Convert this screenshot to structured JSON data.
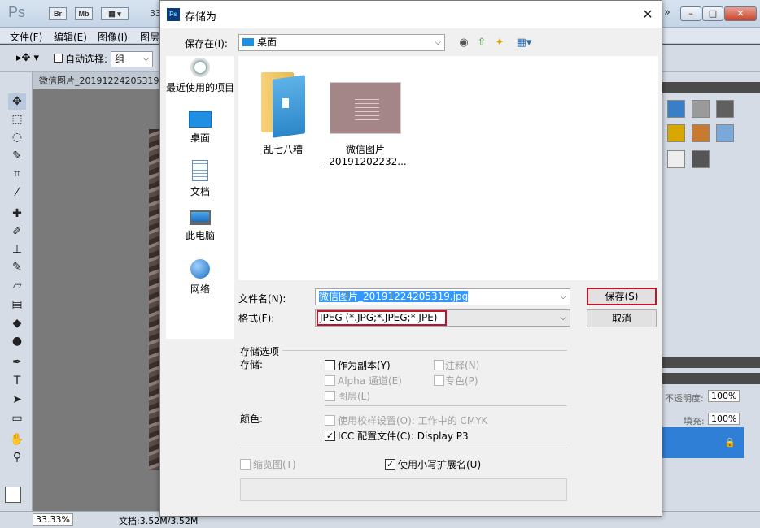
{
  "photoshop": {
    "logo": "Ps",
    "bridge_btn": "Br",
    "minibridge_btn": "Mb",
    "zoom_fragment": "33",
    "menu": [
      "文件(F)",
      "编辑(E)",
      "图像(I)",
      "图层"
    ],
    "options": {
      "auto_select_label": "自动选择:",
      "auto_select_value": "组"
    },
    "doc_tab": "微信图片_20191224205319",
    "status_zoom": "33.33%",
    "status_doc": "文档:3.52M/3.52M",
    "layers": {
      "opacity_label": "不透明度:",
      "opacity_value": "100%",
      "fill_label": "填充:",
      "fill_value": "100%"
    }
  },
  "dialog": {
    "title": "存储为",
    "save_in_label": "保存在(I):",
    "save_in_value": "桌面",
    "places": [
      {
        "label": "最近使用的项目",
        "icon": "recent-items-icon"
      },
      {
        "label": "桌面",
        "icon": "desktop-icon"
      },
      {
        "label": "文档",
        "icon": "documents-icon"
      },
      {
        "label": "此电脑",
        "icon": "this-pc-icon"
      },
      {
        "label": "网络",
        "icon": "network-icon"
      }
    ],
    "files": [
      {
        "name": "乱七八糟",
        "icon": "folder-icon"
      },
      {
        "name": "微信图片\n_20191202232...",
        "icon": "image-thumbnail"
      }
    ],
    "filename_label": "文件名(N):",
    "filename_value": "微信图片_20191224205319.jpg",
    "format_label": "格式(F):",
    "format_value": "JPEG (*.JPG;*.JPEG;*.JPE)",
    "save_button": "保存(S)",
    "cancel_button": "取消",
    "options_title": "存储选项",
    "storage_label": "存储:",
    "as_copy": "作为副本(Y)",
    "notes": "注释(N)",
    "alpha": "Alpha 通道(E)",
    "spot": "专色(P)",
    "layers_opt": "图层(L)",
    "color_label": "颜色:",
    "proof_setup": "使用校样设置(O):  工作中的 CMYK",
    "icc_profile": "ICC 配置文件(C):  Display P3",
    "thumbnail": "缩览图(T)",
    "lowercase_ext": "使用小写扩展名(U)",
    "states": {
      "as_copy": false,
      "icc_profile": true,
      "thumbnail": false,
      "lowercase_ext": true
    }
  }
}
